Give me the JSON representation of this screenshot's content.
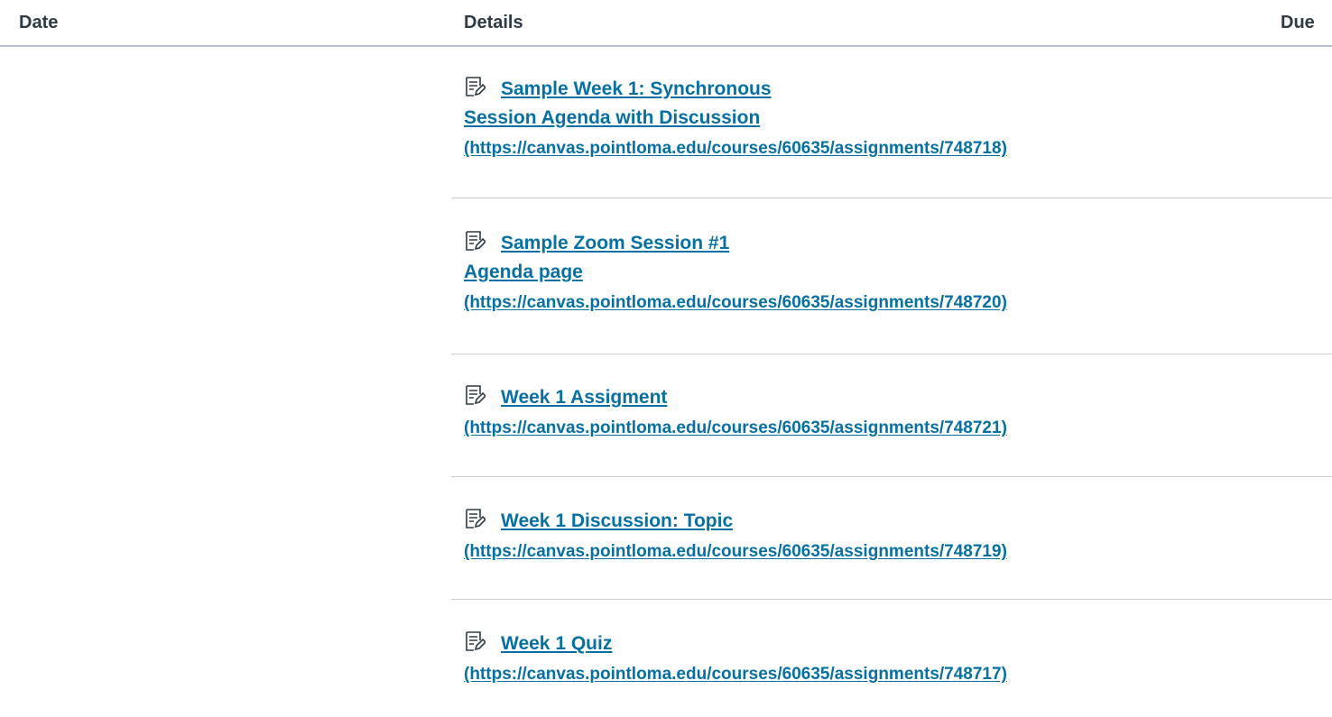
{
  "header": {
    "date_label": "Date",
    "details_label": "Details",
    "due_label": "Due"
  },
  "items": [
    {
      "icon": "assignment-icon",
      "title_line1": "Sample Week 1: Synchronous",
      "title_line2": "Session Agenda with Discussion",
      "url": "(https://canvas.pointloma.edu/courses/60635/assignments/748718)"
    },
    {
      "icon": "assignment-icon",
      "title_line1": "Sample Zoom Session #1",
      "title_line2": "Agenda page",
      "url": "(https://canvas.pointloma.edu/courses/60635/assignments/748720)"
    },
    {
      "icon": "assignment-icon",
      "title_line1": "Week 1 Assigment",
      "url": "(https://canvas.pointloma.edu/courses/60635/assignments/748721)"
    },
    {
      "icon": "assignment-icon",
      "title_line1": "Week 1 Discussion: Topic",
      "url": "(https://canvas.pointloma.edu/courses/60635/assignments/748719)"
    },
    {
      "icon": "assignment-icon",
      "title_line1": "Week 1 Quiz",
      "url": "(https://canvas.pointloma.edu/courses/60635/assignments/748717)"
    }
  ],
  "colors": {
    "link": "#0770a3",
    "text": "#2d3b45",
    "divider": "#c7cdd1"
  }
}
